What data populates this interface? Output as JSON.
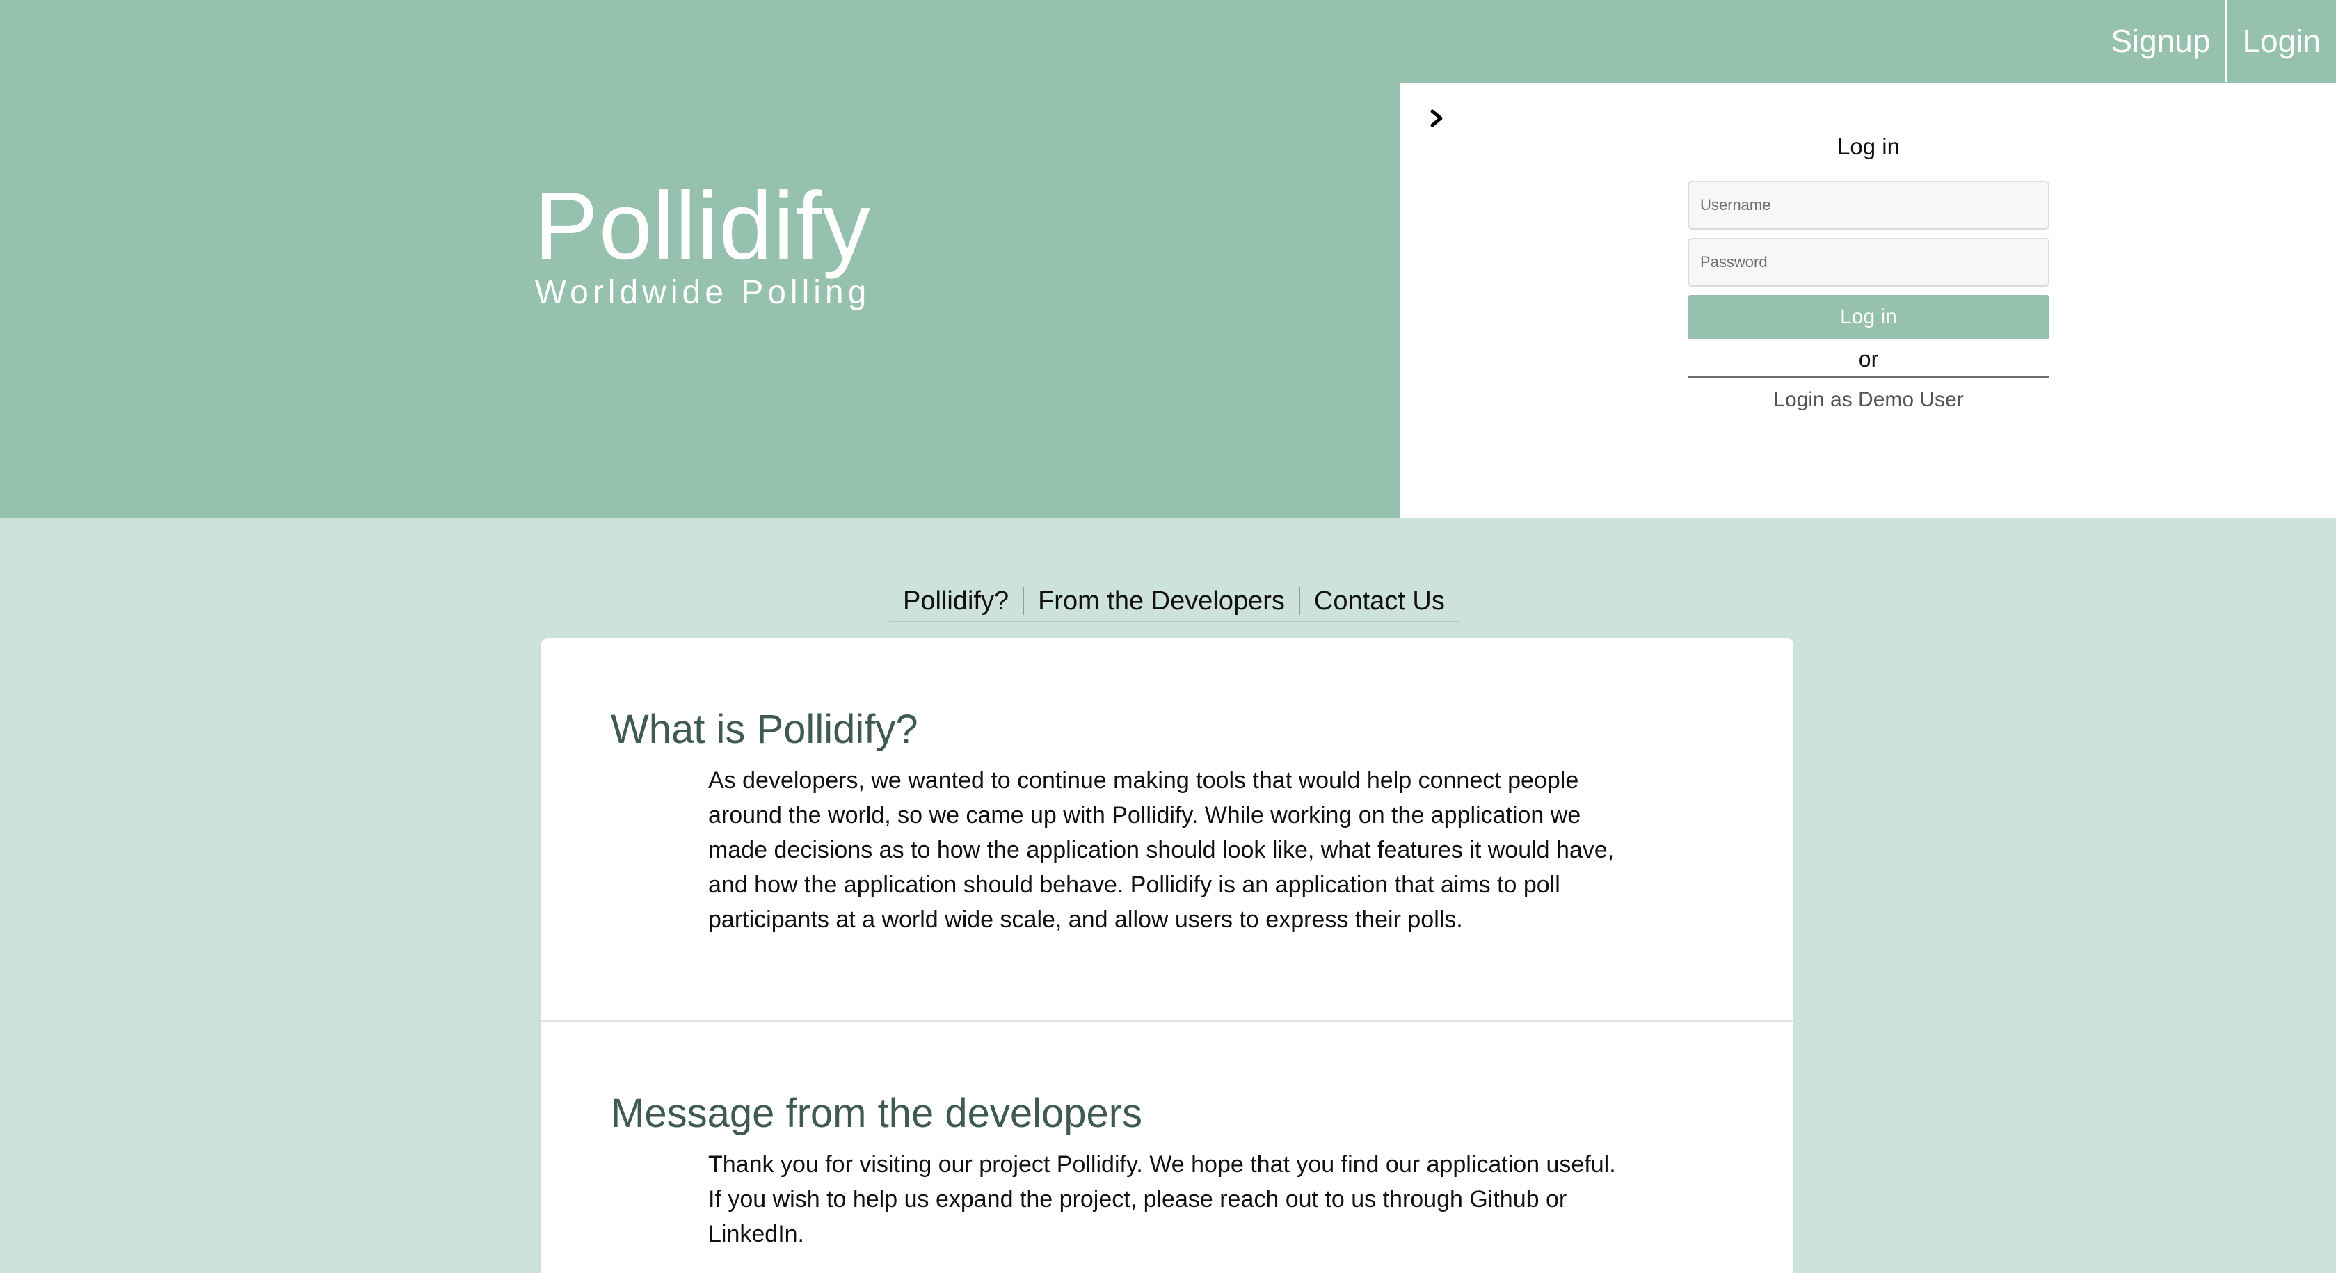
{
  "header": {
    "nav": {
      "signup": "Signup",
      "login": "Login"
    },
    "brand": {
      "title": "Pollidify",
      "subtitle": "Worldwide Polling"
    }
  },
  "login_panel": {
    "collapse_icon": "chevron-right-icon",
    "title": "Log in",
    "username_placeholder": "Username",
    "password_placeholder": "Password",
    "submit_label": "Log in",
    "or_text": "or",
    "demo_label": "Login as Demo User"
  },
  "section_nav": {
    "items": [
      "Pollidify?",
      "From the Developers",
      "Contact Us"
    ]
  },
  "content": {
    "about": {
      "heading": "What is Pollidify?",
      "body": "As developers, we wanted to continue making tools that would help connect people around the world, so we came up with Pollidify. While working on the application we made decisions as to how the application should look like, what features it would have, and how the application should behave. Pollidify is an application that aims to poll participants at a world wide scale, and allow users to express their polls."
    },
    "developers": {
      "heading": "Message from the developers",
      "body": "Thank you for visiting our project Pollidify. We hope that you find our application useful. If you wish to help us expand the project, please reach out to us through Github or LinkedIn."
    }
  },
  "colors": {
    "hero_bg": "#95c1ae",
    "page_bg": "#cde2d8",
    "button_bg": "#95c1ae",
    "heading_text": "#3f5a50"
  }
}
